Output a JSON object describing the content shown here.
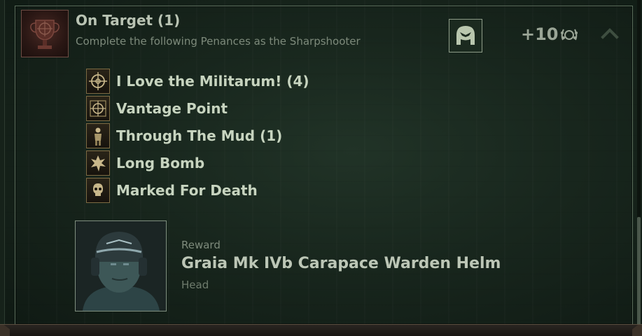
{
  "penance": {
    "title": "On Target (1)",
    "description": "Complete the following Penances as the Sharpshooter",
    "points": "+10",
    "icon": "trophy-crosshair-icon",
    "class_badge_icon": "veteran-helmet-icon"
  },
  "sub_penances": [
    {
      "label": "I Love the Militarum! (4)",
      "icon": "crosshair-icon"
    },
    {
      "label": "Vantage Point",
      "icon": "scope-crosshair-icon"
    },
    {
      "label": "Through The Mud (1)",
      "icon": "soldier-icon"
    },
    {
      "label": "Long Bomb",
      "icon": "explosion-icon"
    },
    {
      "label": "Marked For Death",
      "icon": "skull-icon"
    }
  ],
  "reward": {
    "kicker": "Reward",
    "name": "Graia Mk IVb Carapace Warden Helm",
    "slot": "Head",
    "icon": "carapace-helm-portrait"
  },
  "colors": {
    "title": "#b9c3b3",
    "subtitle": "#7d8a7b",
    "list_text": "#c7d4bf",
    "panel_border": "#5b6e5c"
  }
}
